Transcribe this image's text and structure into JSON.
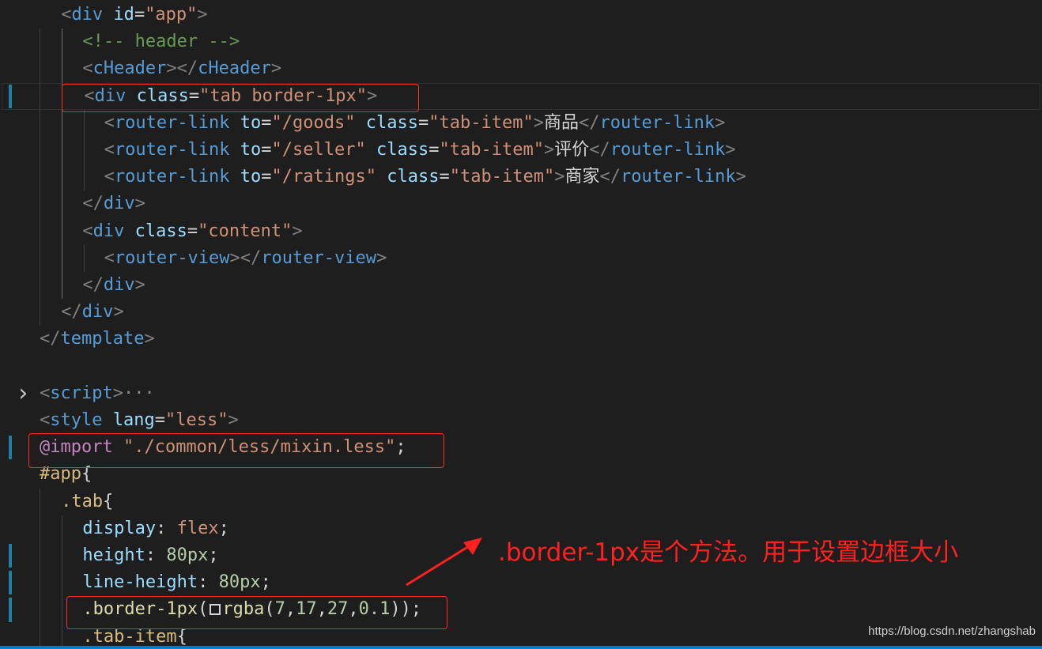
{
  "editor": {
    "lines": [
      [
        {
          "t": "<",
          "c": "punc"
        },
        {
          "t": "div",
          "c": "tag"
        },
        {
          "t": " ",
          "c": "txt"
        },
        {
          "t": "id",
          "c": "attr"
        },
        {
          "t": "=",
          "c": "txt"
        },
        {
          "t": "\"app\"",
          "c": "str"
        },
        {
          "t": ">",
          "c": "punc"
        }
      ],
      [
        {
          "t": "<!-- header -->",
          "c": "cmt"
        }
      ],
      [
        {
          "t": "<",
          "c": "punc"
        },
        {
          "t": "cHeader",
          "c": "tag"
        },
        {
          "t": "></",
          "c": "punc"
        },
        {
          "t": "cHeader",
          "c": "tag"
        },
        {
          "t": ">",
          "c": "punc"
        }
      ],
      [
        {
          "t": "<",
          "c": "punc"
        },
        {
          "t": "div",
          "c": "tag"
        },
        {
          "t": " ",
          "c": "txt"
        },
        {
          "t": "class",
          "c": "attr"
        },
        {
          "t": "=",
          "c": "txt"
        },
        {
          "t": "\"tab border-1px\"",
          "c": "str"
        },
        {
          "t": ">",
          "c": "punc"
        }
      ],
      [
        {
          "t": "<",
          "c": "punc"
        },
        {
          "t": "router-link",
          "c": "tag"
        },
        {
          "t": " ",
          "c": "txt"
        },
        {
          "t": "to",
          "c": "attr"
        },
        {
          "t": "=",
          "c": "txt"
        },
        {
          "t": "\"/goods\"",
          "c": "str"
        },
        {
          "t": " ",
          "c": "txt"
        },
        {
          "t": "class",
          "c": "attr"
        },
        {
          "t": "=",
          "c": "txt"
        },
        {
          "t": "\"tab-item\"",
          "c": "str"
        },
        {
          "t": ">",
          "c": "punc"
        },
        {
          "t": "商品",
          "c": "txt"
        },
        {
          "t": "</",
          "c": "punc"
        },
        {
          "t": "router-link",
          "c": "tag"
        },
        {
          "t": ">",
          "c": "punc"
        }
      ],
      [
        {
          "t": "<",
          "c": "punc"
        },
        {
          "t": "router-link",
          "c": "tag"
        },
        {
          "t": " ",
          "c": "txt"
        },
        {
          "t": "to",
          "c": "attr"
        },
        {
          "t": "=",
          "c": "txt"
        },
        {
          "t": "\"/seller\"",
          "c": "str"
        },
        {
          "t": " ",
          "c": "txt"
        },
        {
          "t": "class",
          "c": "attr"
        },
        {
          "t": "=",
          "c": "txt"
        },
        {
          "t": "\"tab-item\"",
          "c": "str"
        },
        {
          "t": ">",
          "c": "punc"
        },
        {
          "t": "评价",
          "c": "txt"
        },
        {
          "t": "</",
          "c": "punc"
        },
        {
          "t": "router-link",
          "c": "tag"
        },
        {
          "t": ">",
          "c": "punc"
        }
      ],
      [
        {
          "t": "<",
          "c": "punc"
        },
        {
          "t": "router-link",
          "c": "tag"
        },
        {
          "t": " ",
          "c": "txt"
        },
        {
          "t": "to",
          "c": "attr"
        },
        {
          "t": "=",
          "c": "txt"
        },
        {
          "t": "\"/ratings\"",
          "c": "str"
        },
        {
          "t": " ",
          "c": "txt"
        },
        {
          "t": "class",
          "c": "attr"
        },
        {
          "t": "=",
          "c": "txt"
        },
        {
          "t": "\"tab-item\"",
          "c": "str"
        },
        {
          "t": ">",
          "c": "punc"
        },
        {
          "t": "商家",
          "c": "txt"
        },
        {
          "t": "</",
          "c": "punc"
        },
        {
          "t": "router-link",
          "c": "tag"
        },
        {
          "t": ">",
          "c": "punc"
        }
      ],
      [
        {
          "t": "</",
          "c": "punc"
        },
        {
          "t": "div",
          "c": "tag"
        },
        {
          "t": ">",
          "c": "punc"
        }
      ],
      [
        {
          "t": "<",
          "c": "punc"
        },
        {
          "t": "div",
          "c": "tag"
        },
        {
          "t": " ",
          "c": "txt"
        },
        {
          "t": "class",
          "c": "attr"
        },
        {
          "t": "=",
          "c": "txt"
        },
        {
          "t": "\"content\"",
          "c": "str"
        },
        {
          "t": ">",
          "c": "punc"
        }
      ],
      [
        {
          "t": "<",
          "c": "punc"
        },
        {
          "t": "router-view",
          "c": "tag"
        },
        {
          "t": "></",
          "c": "punc"
        },
        {
          "t": "router-view",
          "c": "tag"
        },
        {
          "t": ">",
          "c": "punc"
        }
      ],
      [
        {
          "t": "</",
          "c": "punc"
        },
        {
          "t": "div",
          "c": "tag"
        },
        {
          "t": ">",
          "c": "punc"
        }
      ],
      [
        {
          "t": "</",
          "c": "punc"
        },
        {
          "t": "div",
          "c": "tag"
        },
        {
          "t": ">",
          "c": "punc"
        }
      ],
      [
        {
          "t": "</",
          "c": "punc"
        },
        {
          "t": "template",
          "c": "tag"
        },
        {
          "t": ">",
          "c": "punc"
        }
      ],
      [],
      [
        {
          "t": "<",
          "c": "punc"
        },
        {
          "t": "script",
          "c": "tag"
        },
        {
          "t": ">",
          "c": "punc"
        },
        {
          "t": "···",
          "c": "ellip"
        }
      ],
      [
        {
          "t": "<",
          "c": "punc"
        },
        {
          "t": "style",
          "c": "tag"
        },
        {
          "t": " ",
          "c": "txt"
        },
        {
          "t": "lang",
          "c": "attr"
        },
        {
          "t": "=",
          "c": "txt"
        },
        {
          "t": "\"less\"",
          "c": "str"
        },
        {
          "t": ">",
          "c": "punc"
        }
      ],
      [
        {
          "t": "@import",
          "c": "at"
        },
        {
          "t": " ",
          "c": "txt"
        },
        {
          "t": "\"./common/less/mixin.less\"",
          "c": "str"
        },
        {
          "t": ";",
          "c": "txt"
        }
      ],
      [
        {
          "t": "#app",
          "c": "sel"
        },
        {
          "t": "{",
          "c": "txt"
        }
      ],
      [
        {
          "t": ".tab",
          "c": "sel"
        },
        {
          "t": "{",
          "c": "txt"
        }
      ],
      [
        {
          "t": "display",
          "c": "prop"
        },
        {
          "t": ": ",
          "c": "txt"
        },
        {
          "t": "flex",
          "c": "str"
        },
        {
          "t": ";",
          "c": "txt"
        }
      ],
      [
        {
          "t": "height",
          "c": "prop"
        },
        {
          "t": ": ",
          "c": "txt"
        },
        {
          "t": "80px",
          "c": "num"
        },
        {
          "t": ";",
          "c": "txt"
        }
      ],
      [
        {
          "t": "line-height",
          "c": "prop"
        },
        {
          "t": ": ",
          "c": "txt"
        },
        {
          "t": "80px",
          "c": "num"
        },
        {
          "t": ";",
          "c": "txt"
        }
      ],
      [
        {
          "t": ".border-1px",
          "c": "fn"
        },
        {
          "t": "(",
          "c": "txt"
        },
        {
          "t": "",
          "c": "swatch"
        },
        {
          "t": "rgba",
          "c": "fn"
        },
        {
          "t": "(",
          "c": "txt"
        },
        {
          "t": "7",
          "c": "num"
        },
        {
          "t": ",",
          "c": "txt"
        },
        {
          "t": "17",
          "c": "num"
        },
        {
          "t": ",",
          "c": "txt"
        },
        {
          "t": "27",
          "c": "num"
        },
        {
          "t": ",",
          "c": "txt"
        },
        {
          "t": "0.1",
          "c": "num"
        },
        {
          "t": "));",
          "c": "txt"
        }
      ],
      [
        {
          "t": ".tab-item",
          "c": "sel"
        },
        {
          "t": "{",
          "c": "txt"
        }
      ]
    ]
  },
  "annotation": {
    "text": ".border-1px是个方法。用于设置边框大小"
  },
  "watermark": {
    "text": "https://blog.csdn.net/zhangshab"
  },
  "colors": {
    "highlight": "#ff2a2a",
    "annotation": "#ff2020",
    "accent": "#007acc"
  }
}
